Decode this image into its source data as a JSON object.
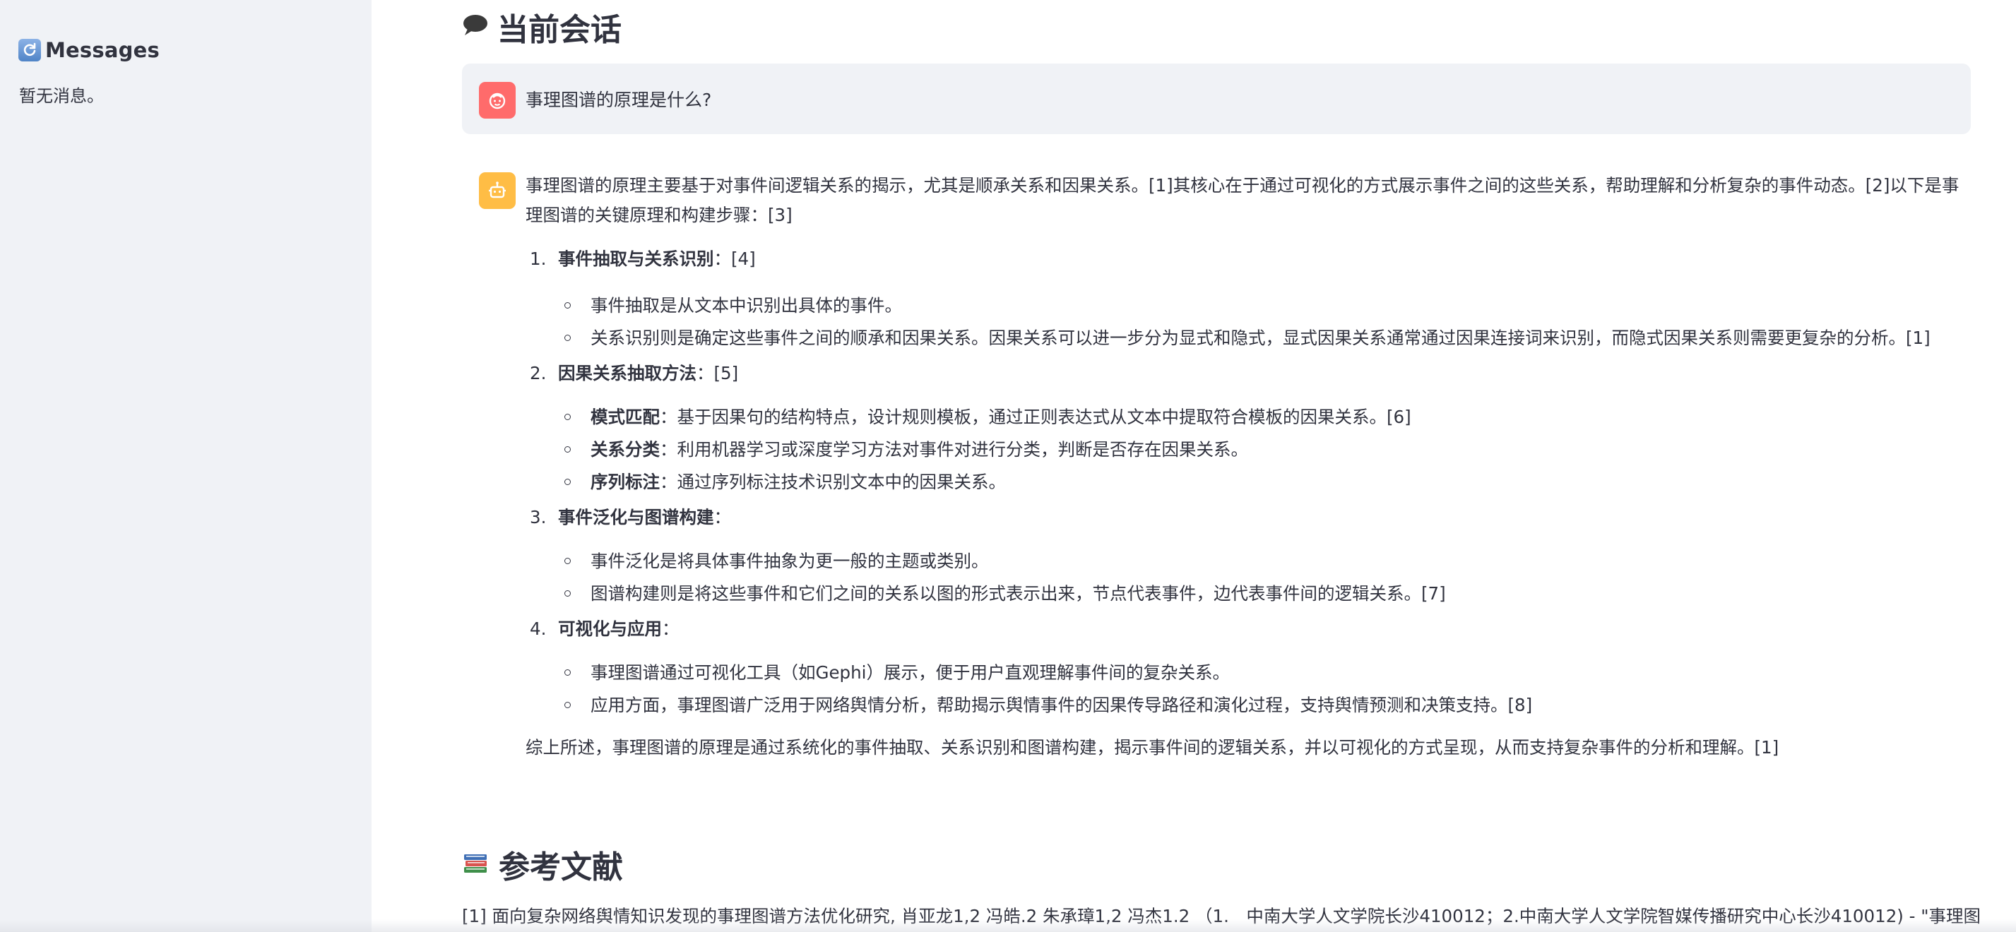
{
  "sidebar": {
    "title": "Messages",
    "empty_text": "暂无消息。",
    "icon": "refresh-icon"
  },
  "main": {
    "conversation_title": "当前会话",
    "conversation_icon": "speech-bubble-icon",
    "user_message": "事理图谱的原理是什么?",
    "user_avatar": "face-icon",
    "bot_avatar": "robot-icon",
    "answer": {
      "intro": "事理图谱的原理主要基于对事件间逻辑关系的揭示，尤其是顺承关系和因果关系。[1]其核心在于通过可视化的方式展示事件之间的这些关系，帮助理解和分析复杂的事件动态。[2]以下是事理图谱的关键原理和构建步骤：[3]",
      "items": [
        {
          "num": "1.",
          "title": "事件抽取与关系识别",
          "suffix": "：[4]",
          "subs": [
            {
              "bold": "",
              "text": "事件抽取是从文本中识别出具体的事件。"
            },
            {
              "bold": "",
              "text": "关系识别则是确定这些事件之间的顺承和因果关系。因果关系可以进一步分为显式和隐式，显式因果关系通常通过因果连接词来识别，而隐式因果关系则需要更复杂的分析。[1]"
            }
          ]
        },
        {
          "num": "2.",
          "title": "因果关系抽取方法",
          "suffix": "：[5]",
          "subs": [
            {
              "bold": "模式匹配",
              "text": "：基于因果句的结构特点，设计规则模板，通过正则表达式从文本中提取符合模板的因果关系。[6]"
            },
            {
              "bold": "关系分类",
              "text": "：利用机器学习或深度学习方法对事件对进行分类，判断是否存在因果关系。"
            },
            {
              "bold": "序列标注",
              "text": "：通过序列标注技术识别文本中的因果关系。"
            }
          ]
        },
        {
          "num": "3.",
          "title": "事件泛化与图谱构建",
          "suffix": "：",
          "subs": [
            {
              "bold": "",
              "text": "事件泛化是将具体事件抽象为更一般的主题或类别。"
            },
            {
              "bold": "",
              "text": "图谱构建则是将这些事件和它们之间的关系以图的形式表示出来，节点代表事件，边代表事件间的逻辑关系。[7]"
            }
          ]
        },
        {
          "num": "4.",
          "title": "可视化与应用",
          "suffix": "：",
          "subs": [
            {
              "bold": "",
              "text": "事理图谱通过可视化工具（如Gephi）展示，便于用户直观理解事件间的复杂关系。"
            },
            {
              "bold": "",
              "text": "应用方面，事理图谱广泛用于网络舆情分析，帮助揭示舆情事件的因果传导路径和演化过程，支持舆情预测和决策支持。[8]"
            }
          ]
        }
      ],
      "summary": "综上所述，事理图谱的原理是通过系统化的事件抽取、关系识别和图谱构建，揭示事件间的逻辑关系，并以可视化的方式呈现，从而支持复杂事件的分析和理解。[1]"
    },
    "references_title": "参考文献",
    "references_icon": "books-icon",
    "references": [
      "[1] 面向复杂网络舆情知识发现的事理图谱方法优化研究, 肖亚龙1,2 冯皓.2 朱承璋1,2 冯杰1.2 （1.　中南大学人文学院长沙410012；2.中南大学人文学院智媒传播研究中心长沙410012) - \"事理图"
    ]
  }
}
